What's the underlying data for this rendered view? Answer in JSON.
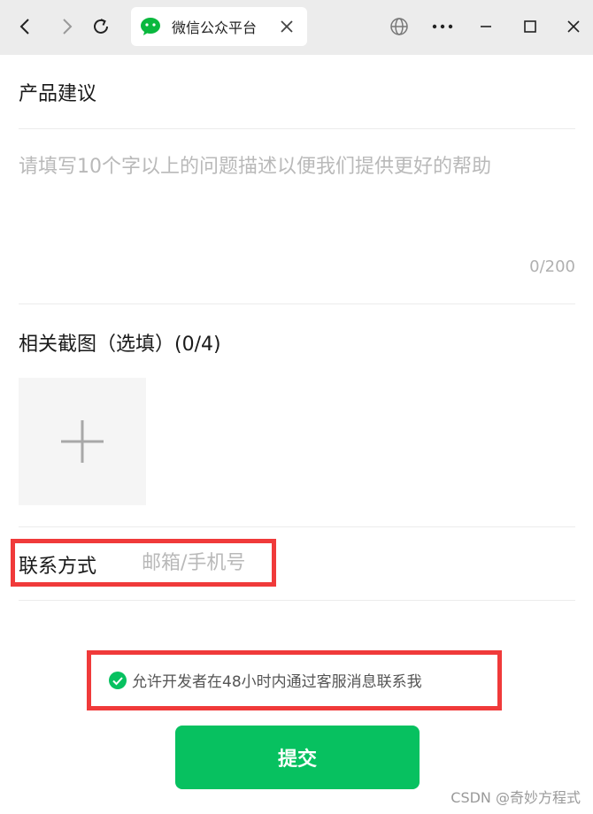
{
  "browser": {
    "tab_title": "微信公众平台"
  },
  "form": {
    "section_title": "产品建议",
    "description_placeholder": "请填写10个字以上的问题描述以便我们提供更好的帮助",
    "char_counter": "0/200",
    "screenshots_title": "相关截图（选填）(0/4)",
    "contact_label": "联系方式",
    "contact_placeholder": "邮箱/手机号",
    "contact_value": "",
    "consent_text": "允许开发者在48小时内通过客服消息联系我",
    "consent_checked": true,
    "submit_label": "提交"
  },
  "watermark": "CSDN @奇妙方程式",
  "colors": {
    "accent": "#07c160",
    "highlight_border": "#f03a3a"
  }
}
